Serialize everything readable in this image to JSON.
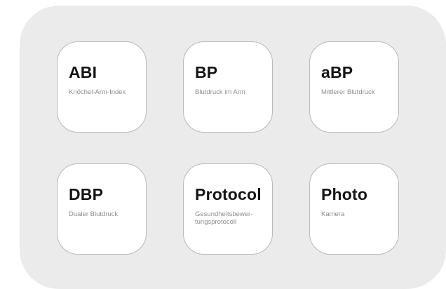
{
  "tiles": [
    {
      "title": "ABI",
      "subtitle": "Knöchel-Arm-Index"
    },
    {
      "title": "BP",
      "subtitle": "Blutdruck im Arm"
    },
    {
      "title": "aBP",
      "subtitle": "Mittlerer Blutdruck"
    },
    {
      "title": "DBP",
      "subtitle": "Dualer Blutdruck"
    },
    {
      "title": "Protocol",
      "subtitle": "Gesundheitsbewer-\ntungsprotocoll"
    },
    {
      "title": "Photo",
      "subtitle": "Kamera"
    }
  ]
}
